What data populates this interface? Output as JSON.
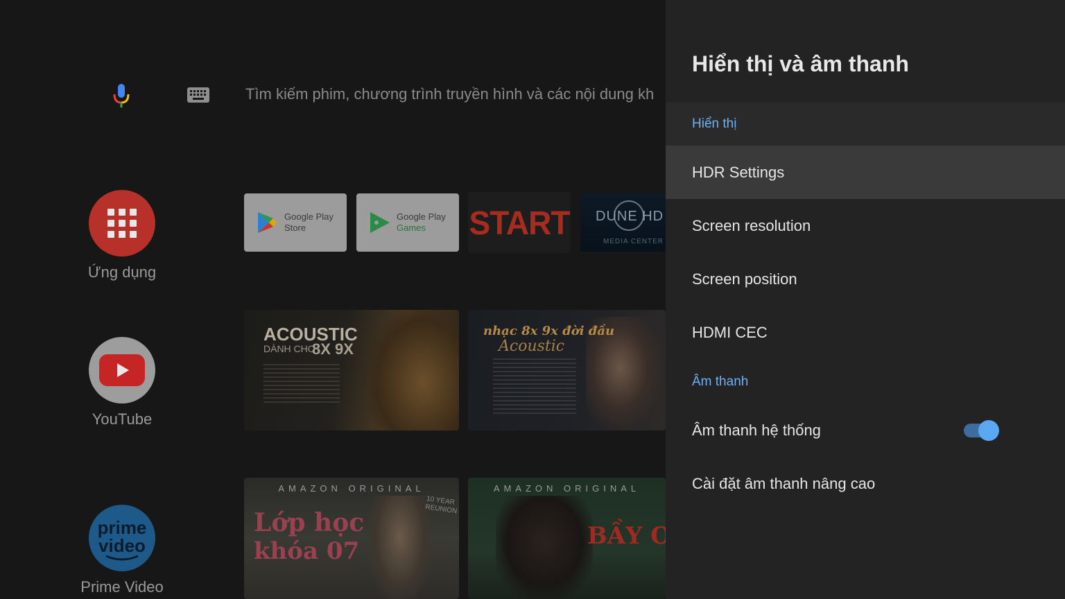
{
  "search": {
    "placeholder": "Tìm kiếm phim, chương trình truyền hình và các nội dung kh"
  },
  "apps": [
    {
      "label": "Ứng dụng",
      "color": "#b8302a"
    },
    {
      "label": "YouTube",
      "color": "#c62525"
    },
    {
      "label": "Prime Video",
      "color": "#1d5a8a"
    }
  ],
  "channels": {
    "play_store": {
      "line1": "Google Play",
      "line2": "Store"
    },
    "play_games": {
      "line1": "Google Play",
      "line2": "Games"
    },
    "start": {
      "label": "START"
    },
    "dune": {
      "brand": "DUNE HD",
      "sub": "MEDIA CENTER"
    }
  },
  "thumbnails": {
    "acoustic1": {
      "title": "ACOUSTIC",
      "subtitle_a": "DÀNH CHO",
      "subtitle_b": "8X 9X"
    },
    "acoustic2": {
      "title": "nhạc 8x 9x đời đầu",
      "subtitle": "Acoustic"
    },
    "amazon1": {
      "badge": "AMAZON ORIGINAL",
      "title_line1": "Lớp học",
      "title_line2": "khóa 07",
      "tag": "10 YEAR REUNION"
    },
    "amazon2": {
      "badge": "AMAZON ORIGINAL",
      "title": "BẦY ONG"
    }
  },
  "panel": {
    "title": "Hiển thị và âm thanh",
    "section_display": "Hiển thị",
    "items_display": [
      "HDR Settings",
      "Screen resolution",
      "Screen position",
      "HDMI CEC"
    ],
    "section_sound": "Âm thanh",
    "system_sound": {
      "label": "Âm thanh hệ thống",
      "enabled": true
    },
    "advanced_sound": "Cài đặt âm thanh nâng cao",
    "accent_color": "#6fb1f5"
  }
}
